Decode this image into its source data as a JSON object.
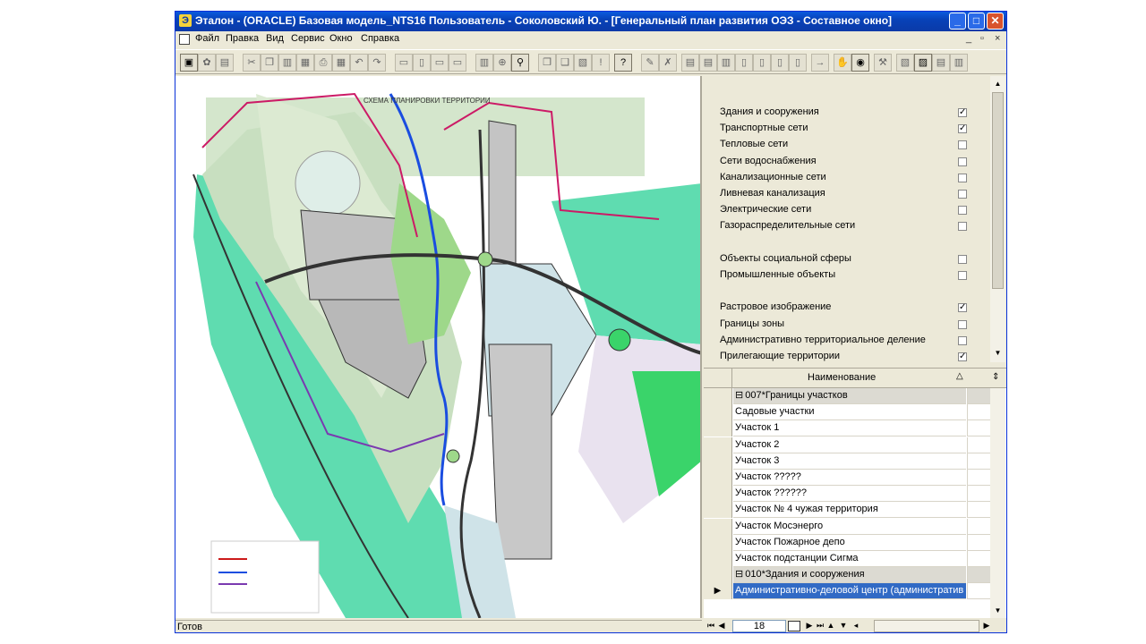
{
  "window": {
    "title": "Эталон - (ORACLE) Базовая модель_NTS16  Пользователь - Соколовский Ю.  - [Генеральный план развития ОЭЗ - Составное окно]",
    "app_icon_glyph": "Э",
    "controls": {
      "minimize": "_",
      "maximize": "□",
      "close": "✕"
    }
  },
  "menu": {
    "items": [
      "Файл",
      "Правка",
      "Вид",
      "Сервис",
      "Окно",
      "Справка"
    ],
    "mdi_controls": {
      "minimize": "_",
      "restore": "▫",
      "close": "×"
    }
  },
  "toolbar": {
    "tools": [
      "open-icon",
      "gear-icon",
      "save-icon",
      "cut-icon",
      "copy-icon",
      "paste-icon",
      "preview-icon",
      "print-icon",
      "table-icon",
      "undo-icon",
      "redo-icon",
      "page-icon",
      "edit-page-icon",
      "page-list-icon",
      "page-view-icon",
      "filter-icon",
      "search-icon",
      "binoculars-icon",
      "copy-doc-icon",
      "link-icon",
      "properties-icon",
      "exclamation-icon",
      "help-icon",
      "attach-icon",
      "delete-icon",
      "report-icon",
      "report2-icon",
      "export-icon",
      "doc1-icon",
      "doc2-icon",
      "doc3-icon",
      "doc4-icon",
      "arrow-right-icon",
      "map-hand-icon",
      "globe-icon",
      "tools-icon",
      "layer-map-icon",
      "map-edit-icon",
      "map-print-icon",
      "map-export-icon"
    ],
    "glyphs": [
      "▣",
      "✿",
      "▤",
      "✂",
      "❐",
      "▥",
      "▦",
      "⎙",
      "▦",
      "↶",
      "↷",
      "▭",
      "▯",
      "▭",
      "▭",
      "▥",
      "⊕",
      "⚲",
      "❐",
      "❑",
      "▧",
      "!",
      "?",
      "✎",
      "✗",
      "▤",
      "▤",
      "▥",
      "▯",
      "▯",
      "▯",
      "▯",
      "→",
      "✋",
      "◉",
      "⚒",
      "▧",
      "▨",
      "▤",
      "▥"
    ]
  },
  "map": {
    "title": "СХЕМА ПЛАНИРОВКИ ТЕРРИТОРИИ",
    "colors": {
      "green": "#c8dfc0",
      "teal": "#4fd9a8",
      "lightblue": "#cfe3e8",
      "pink": "#f0d8e0",
      "grey": "#9a9a9a",
      "road": "#333333"
    }
  },
  "layers": [
    {
      "label": "Здания и сооружения",
      "checked": true
    },
    {
      "label": "Транспортные сети",
      "checked": true
    },
    {
      "label": "Тепловые сети",
      "checked": false
    },
    {
      "label": "Сети водоснабжения",
      "checked": false
    },
    {
      "label": "Канализационные сети",
      "checked": false
    },
    {
      "label": "Ливневая канализация",
      "checked": false
    },
    {
      "label": "Электрические сети",
      "checked": false
    },
    {
      "label": "Газораспределительные сети",
      "checked": false
    },
    {
      "label": "",
      "checked": null
    },
    {
      "label": "Объекты социальной сферы",
      "checked": false
    },
    {
      "label": "Промышленные объекты",
      "checked": false
    },
    {
      "label": "",
      "checked": null
    },
    {
      "label": "Растровое изображение",
      "checked": true
    },
    {
      "label": "Границы зоны",
      "checked": false
    },
    {
      "label": "Административно территориальное деление",
      "checked": false
    },
    {
      "label": "Прилегающие территории",
      "checked": true
    }
  ],
  "grid": {
    "header": "Наименование",
    "header_sort_glyph": "△",
    "rows": [
      {
        "text": "007*Границы участков",
        "type": "group",
        "expander": "⊟"
      },
      {
        "text": "Садовые участки",
        "type": "item"
      },
      {
        "text": "Участок 1",
        "type": "item"
      },
      {
        "text": "Участок 2",
        "type": "item"
      },
      {
        "text": "Участок 3",
        "type": "item"
      },
      {
        "text": "Участок ?????",
        "type": "item"
      },
      {
        "text": "Участок ??????",
        "type": "item"
      },
      {
        "text": "Участок № 4 чужая территория",
        "type": "item"
      },
      {
        "text": "Участок Мосэнерго",
        "type": "item"
      },
      {
        "text": "Участок Пожарное депо",
        "type": "item"
      },
      {
        "text": "Участок подстанции Сигма",
        "type": "item"
      },
      {
        "text": "010*Здания и сооружения",
        "type": "group",
        "expander": "⊟"
      },
      {
        "text": "Административно-деловой центр (административ",
        "type": "selected",
        "marker": "▶"
      }
    ]
  },
  "navigator": {
    "record": "18",
    "buttons": [
      "⏮",
      "◀",
      "▶",
      "⏭",
      "▲",
      "▼",
      "◂"
    ]
  },
  "status": {
    "text": "Готов"
  }
}
